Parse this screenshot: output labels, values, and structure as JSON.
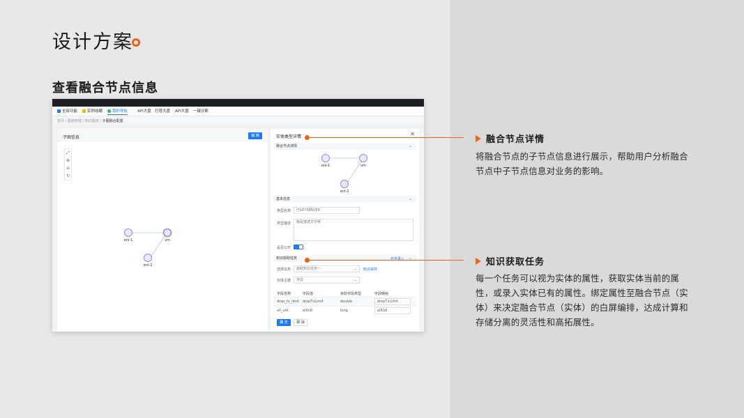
{
  "slide": {
    "title": "设计方案",
    "section_title": "查看融合节点信息"
  },
  "screenshot": {
    "topbar_text": "",
    "nav": {
      "items": [
        {
          "label": "全部功能",
          "icon": "grid-icon",
          "color": "#1f7bf3"
        },
        {
          "label": "实例收藏",
          "icon": "folder-icon",
          "color": "#f5b400"
        },
        {
          "label": "我的导航",
          "icon": "user-icon",
          "color": "#2bb673"
        },
        {
          "label": "API大盘",
          "icon": "",
          "color": ""
        },
        {
          "label": "灯塔大盘",
          "icon": "",
          "color": ""
        },
        {
          "label": "API大盘",
          "icon": "",
          "color": ""
        },
        {
          "label": "一键诊断",
          "icon": "",
          "color": ""
        }
      ]
    },
    "breadcrumb": {
      "items": [
        "首页",
        "图谱管理",
        "知识图谱"
      ],
      "current": "子图融合配置",
      "separator": "/"
    },
    "left_panel": {
      "title": "子图信息",
      "edit_button": "编 辑",
      "tools": [
        "⤢",
        "⊕",
        "⊖",
        "↻"
      ],
      "graph_nodes": [
        "eni-1",
        "vm",
        "eni-2"
      ]
    },
    "right_panel": {
      "title": "实体类型详情",
      "close": "✕",
      "fusion_section": "融合节点详情",
      "fusion_nodes": [
        "eni-1",
        "vm",
        "eni-2"
      ],
      "basic_section": "基本信息",
      "type_name_label": "类型名称",
      "type_name_value": "已KEYSERVER",
      "type_desc_label": "类型描述",
      "type_desc_value": "我是描述文字呀",
      "public_label": "是否公开",
      "task_section": "知识获取任务",
      "task_link": "任务录入",
      "select_task_label": "选择任务",
      "select_task_value": "获取知识任务一",
      "task_detail_link": "知识采样",
      "entity_key_label": "实体主键",
      "entity_key_value": "字段",
      "table": {
        "headers": [
          "字段名称",
          "字段值",
          "目标字段类型",
          "字段映射"
        ],
        "rows": [
          [
            "drop_tx_limit",
            "dropTxLimit",
            "double",
            "dropTxLimit"
          ],
          [
            "ali_uid",
            "aliUid",
            "long",
            "aliUid"
          ]
        ]
      },
      "ok_button": "确 定",
      "cancel_button": "取 消"
    }
  },
  "callouts": [
    {
      "heading": "融合节点详情",
      "body": "将融合节点的子节点信息进行展示，帮助用户分析融合节点中子节点信息对业务的影响。"
    },
    {
      "heading": "知识获取任务",
      "body": "每一个任务可以视为实体的属性，获取实体当前的属性，或录入实体已有的属性。绑定属性至融合节点（实体）来决定融合节点（实体）的白屏编排，达成计算和存储分离的灵活性和高拓展性。"
    }
  ],
  "colors": {
    "accent": "#e8641b",
    "primary": "#1f7bf3"
  }
}
